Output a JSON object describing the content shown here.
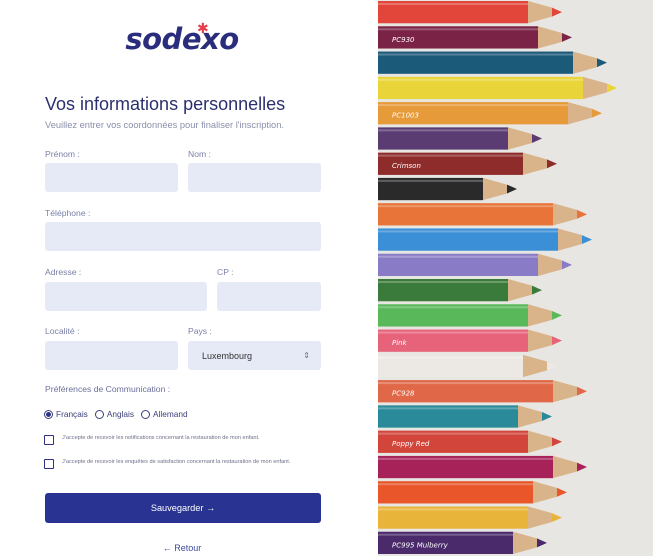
{
  "brand": {
    "logo_text": "sodexo"
  },
  "form": {
    "title": "Vos informations personnelles",
    "subtitle": "Veuillez entrer vos coordonnées pour finaliser l'inscription.",
    "fields": {
      "prenom": {
        "label": "Prénom :",
        "value": ""
      },
      "nom": {
        "label": "Nom :",
        "value": ""
      },
      "telephone": {
        "label": "Téléphone :",
        "value": ""
      },
      "adresse": {
        "label": "Adresse :",
        "value": ""
      },
      "cp": {
        "label": "CP :",
        "value": ""
      },
      "localite": {
        "label": "Localité :",
        "value": ""
      },
      "pays": {
        "label": "Pays :",
        "value": "Luxembourg",
        "chevron": "⇕"
      }
    },
    "preferences": {
      "label": "Préférences de Communication :",
      "languages": [
        {
          "label": "Français",
          "selected": true
        },
        {
          "label": "Anglais",
          "selected": false
        },
        {
          "label": "Allemand",
          "selected": false
        }
      ]
    },
    "consents": [
      {
        "label": "J'accepte de recevoir les notifications concernant la restauration de mon enfant.",
        "checked": false
      },
      {
        "label": "J'accepte de recevoir les enquêtes de satisfaction concernant la restauration de mon enfant.",
        "checked": false
      }
    ],
    "save_label": "Sauvegarder →",
    "back_label": "← Retour"
  },
  "photo": {
    "description_colors": {
      "accent": "#283392",
      "field_bg": "#e6eaf6",
      "logo_star": "#e63d4b"
    },
    "pencils": [
      {
        "color": "#e2463a",
        "label": ""
      },
      {
        "color": "#7a2346",
        "label": "PC930"
      },
      {
        "color": "#1c5a7a",
        "label": ""
      },
      {
        "color": "#e9d43a",
        "label": ""
      },
      {
        "color": "#e79a3a",
        "label": "PC1003"
      },
      {
        "color": "#5a3c72",
        "label": ""
      },
      {
        "color": "#8e2c2c",
        "label": "Crimson"
      },
      {
        "color": "#2a2a2a",
        "label": ""
      },
      {
        "color": "#e8743a",
        "label": ""
      },
      {
        "color": "#3a8fd6",
        "label": ""
      },
      {
        "color": "#8a7bc6",
        "label": ""
      },
      {
        "color": "#3a7a3a",
        "label": ""
      },
      {
        "color": "#58b85a",
        "label": ""
      },
      {
        "color": "#e7637a",
        "label": "Pink"
      },
      {
        "color": "#ece9e4",
        "label": ""
      },
      {
        "color": "#e06848",
        "label": "PC928"
      },
      {
        "color": "#2a8a9a",
        "label": ""
      },
      {
        "color": "#d2453a",
        "label": "Poppy Red"
      },
      {
        "color": "#a8225a",
        "label": ""
      },
      {
        "color": "#e8562a",
        "label": ""
      },
      {
        "color": "#e9b43a",
        "label": ""
      },
      {
        "color": "#4a2a6a",
        "label": "PC995 Mulberry"
      }
    ]
  }
}
